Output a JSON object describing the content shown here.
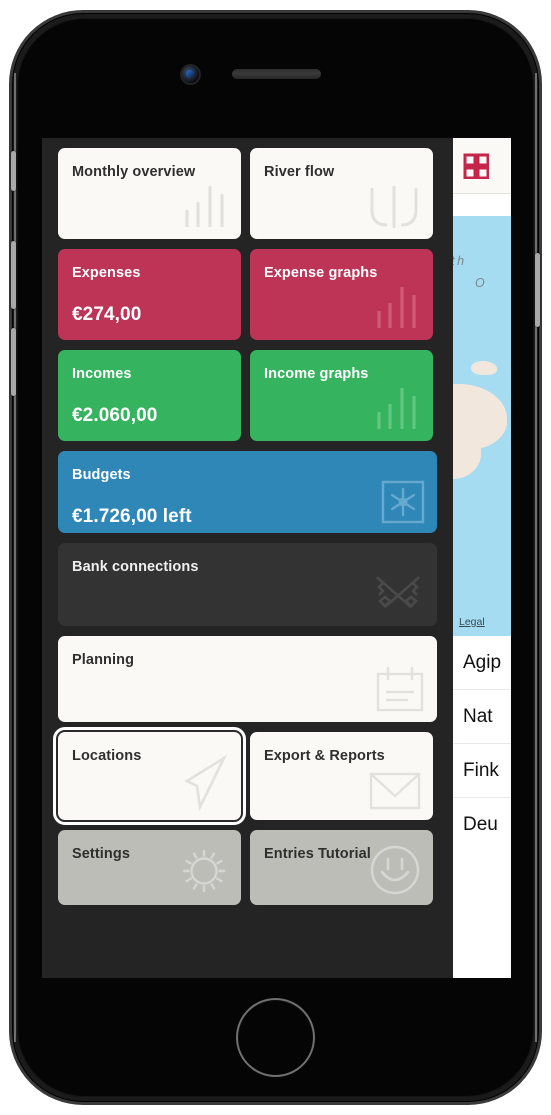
{
  "device": {
    "name": "smartphone-mockup",
    "camera": "front-camera",
    "speaker": "earpiece-speaker",
    "home_button": "home-button",
    "buttons": [
      "silent-switch",
      "volume-up",
      "volume-down",
      "power"
    ]
  },
  "screen": {
    "rows": [
      {
        "cards": [
          {
            "id": "monthly-overview",
            "title": "Monthly overview",
            "amount": "",
            "style": "c-light",
            "icon": "bar-chart-icon",
            "size": "half",
            "height": "h1"
          },
          {
            "id": "river-flow",
            "title": "River flow",
            "amount": "",
            "style": "c-light",
            "icon": "river-flow-icon",
            "size": "half",
            "height": "h1"
          }
        ]
      },
      {
        "cards": [
          {
            "id": "expenses",
            "title": "Expenses",
            "amount": "€274,00",
            "style": "c-crimson",
            "icon": "",
            "size": "half",
            "height": "h2"
          },
          {
            "id": "expense-graphs",
            "title": "Expense graphs",
            "amount": "",
            "style": "c-crimson",
            "icon": "bar-chart-icon",
            "size": "half",
            "height": "h2"
          }
        ]
      },
      {
        "cards": [
          {
            "id": "incomes",
            "title": "Incomes",
            "amount": "€2.060,00",
            "style": "c-green",
            "icon": "",
            "size": "half",
            "height": "h3"
          },
          {
            "id": "income-graphs",
            "title": "Income graphs",
            "amount": "",
            "style": "c-green",
            "icon": "bar-chart-icon",
            "size": "half",
            "height": "h3"
          }
        ]
      },
      {
        "cards": [
          {
            "id": "budgets",
            "title": "Budgets",
            "amount": "€1.726,00 left",
            "style": "c-blue",
            "icon": "budget-box-icon",
            "size": "full",
            "height": "h-budget"
          }
        ]
      },
      {
        "cards": [
          {
            "id": "bank-connections",
            "title": "Bank connections",
            "amount": "",
            "style": "c-dark",
            "icon": "crossed-keys-icon",
            "size": "full",
            "height": "h-bank"
          }
        ]
      },
      {
        "cards": [
          {
            "id": "planning",
            "title": "Planning",
            "amount": "",
            "style": "c-light",
            "icon": "calendar-icon",
            "size": "full",
            "height": "h-plan"
          }
        ]
      },
      {
        "cards": [
          {
            "id": "locations",
            "title": "Locations",
            "amount": "",
            "style": "c-light",
            "icon": "navigation-arrow-icon",
            "size": "half",
            "height": "h-loc",
            "focused": true
          },
          {
            "id": "export-reports",
            "title": "Export & Reports",
            "amount": "",
            "style": "c-light",
            "icon": "envelope-icon",
            "size": "half",
            "height": "h-loc"
          }
        ]
      },
      {
        "cards": [
          {
            "id": "settings",
            "title": "Settings",
            "amount": "",
            "style": "c-gray",
            "icon": "gear-sun-icon",
            "size": "half",
            "height": "h-set"
          },
          {
            "id": "entries-tutorial",
            "title": "Entries Tutorial",
            "amount": "",
            "style": "c-gray",
            "icon": "smiley-icon",
            "size": "half",
            "height": "h-set"
          }
        ]
      }
    ],
    "side_pane": {
      "grid_icon": "grid-2x2-icon",
      "map": {
        "label_1": "orth",
        "label_2": "O",
        "legal_link": "Legal"
      },
      "list": [
        {
          "label": "Agip"
        },
        {
          "label": "Nat"
        },
        {
          "label": "Fink"
        },
        {
          "label": "Deu"
        }
      ]
    }
  },
  "colors": {
    "crimson": "#bd3457",
    "green": "#35b35e",
    "blue": "#2f87b8",
    "light": "#faf9f5",
    "dark_card": "#333333",
    "gray_card": "#bdbdb8",
    "screen_bg": "#242424",
    "map_water": "#a5dcf2",
    "map_land": "#f2e7dc"
  }
}
